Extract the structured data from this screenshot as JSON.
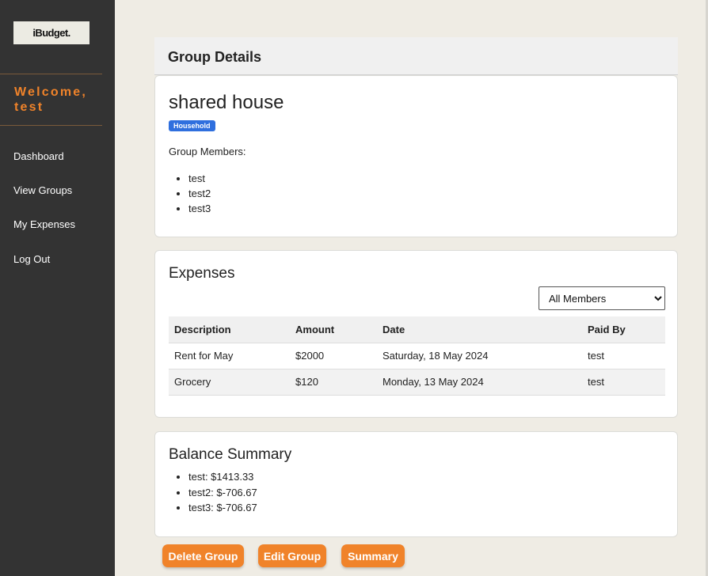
{
  "sidebar": {
    "logo_text": "iBudget.",
    "welcome": "Welcome, test",
    "nav": [
      "Dashboard",
      "View Groups",
      "My Expenses",
      "Log Out"
    ]
  },
  "header": {
    "title": "Group Details"
  },
  "group": {
    "name": "shared house",
    "badge": "Household",
    "members_label": "Group Members:",
    "members": [
      "test",
      "test2",
      "test3"
    ]
  },
  "expenses": {
    "title": "Expenses",
    "filter_selected": "All Members",
    "columns": [
      "Description",
      "Amount",
      "Date",
      "Paid By"
    ],
    "rows": [
      [
        "Rent for May",
        "$2000",
        "Saturday, 18 May 2024",
        "test"
      ],
      [
        "Grocery",
        "$120",
        "Monday, 13 May 2024",
        "test"
      ]
    ]
  },
  "balance": {
    "title": "Balance Summary",
    "items": [
      "test: $1413.33",
      "test2: $-706.67",
      "test3: $-706.67"
    ]
  },
  "actions": {
    "delete_label": "Delete Group",
    "edit_label": "Edit Group",
    "summary_label": "Summary"
  },
  "colors": {
    "accent": "#f0832a",
    "sidebar": "#333333",
    "badge": "#2f6fde",
    "background": "#efece4"
  }
}
